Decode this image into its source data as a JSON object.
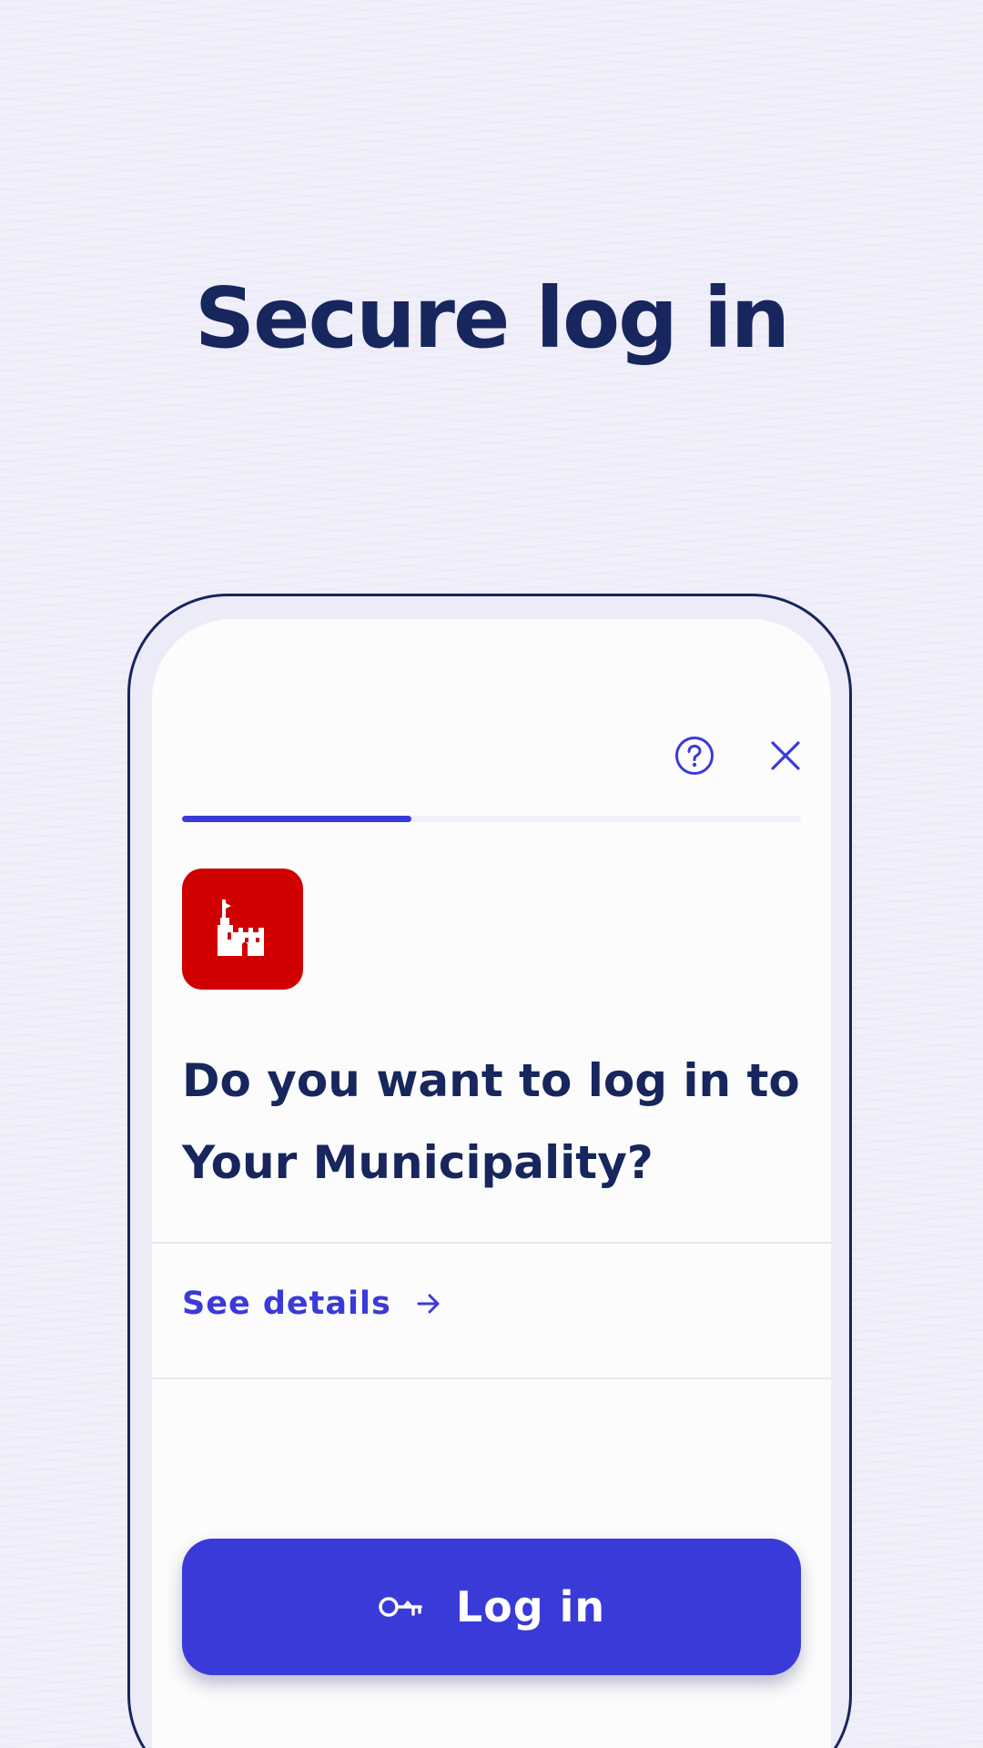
{
  "page": {
    "headline": "Secure log in"
  },
  "header": {
    "help_icon": "help-circle-icon",
    "close_icon": "close-icon"
  },
  "progress": {
    "value_fraction": 0.37
  },
  "app": {
    "logo_icon": "castle-icon",
    "logo_color": "#d10000"
  },
  "prompt": {
    "line1": "Do you want to log in to",
    "line2": "Your Municipality?"
  },
  "details": {
    "label": "See details",
    "icon": "arrow-right-icon"
  },
  "login": {
    "label": "Log in",
    "icon": "key-icon"
  },
  "colors": {
    "accent": "#3a3ad9",
    "text": "#17265c",
    "background": "#f0effa"
  }
}
